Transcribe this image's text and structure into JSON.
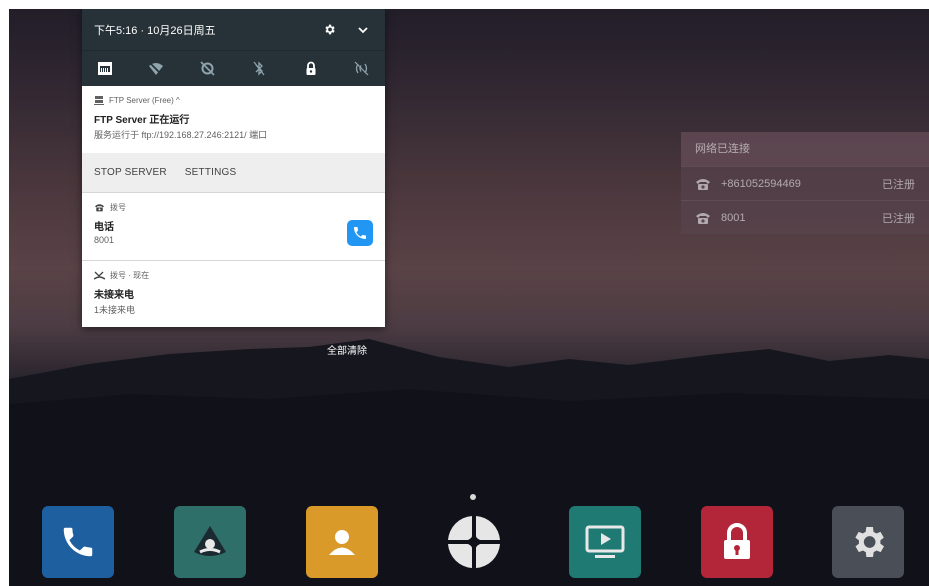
{
  "status_bar": {
    "time": "下午5:16 · 10月26日周五",
    "settings_icon": "gear-icon",
    "expand_icon": "chevron-down-icon"
  },
  "quick_settings": [
    "ethernet-icon",
    "wifi-off-icon",
    "sync-off-icon",
    "bluetooth-off-icon",
    "lock-icon",
    "nfc-off-icon"
  ],
  "notifications": {
    "ftp": {
      "app": "FTP Server (Free) ^",
      "title": "FTP Server 正在运行",
      "text": "服务运行于 ftp://192.168.27.246:2121/ 端口",
      "actions": [
        "STOP SERVER",
        "SETTINGS"
      ]
    },
    "dial": {
      "app": "拨号",
      "title": "电话",
      "text": "8001"
    },
    "missed": {
      "app": "拨号 · 现在",
      "title": "未接来电",
      "text": "1未接来电"
    }
  },
  "clear_all": "全部清除",
  "status_widget": {
    "title": "网络已连接",
    "accounts": [
      {
        "number": "+861052594469",
        "status": "已注册"
      },
      {
        "number": "8001",
        "status": "已注册"
      }
    ]
  },
  "dock": [
    {
      "name": "phone-app",
      "icon": "phone-icon",
      "color": "#1e5fa0"
    },
    {
      "name": "conference-app",
      "icon": "conference-icon",
      "color": "#2e6f6a"
    },
    {
      "name": "contacts-app",
      "icon": "contacts-icon",
      "color": "#d99a2a"
    },
    {
      "name": "pinwheel-app",
      "icon": "pinwheel-icon",
      "color": "#e6e6e6"
    },
    {
      "name": "presentation-app",
      "icon": "presentation-icon",
      "color": "#1f7a74"
    },
    {
      "name": "lock-app",
      "icon": "lock-icon",
      "color": "#b3263a"
    },
    {
      "name": "settings-app",
      "icon": "gear-icon",
      "color": "#4a4f57"
    }
  ],
  "colors": {
    "panel_header": "#263238",
    "accent_blue": "#2196f3"
  }
}
